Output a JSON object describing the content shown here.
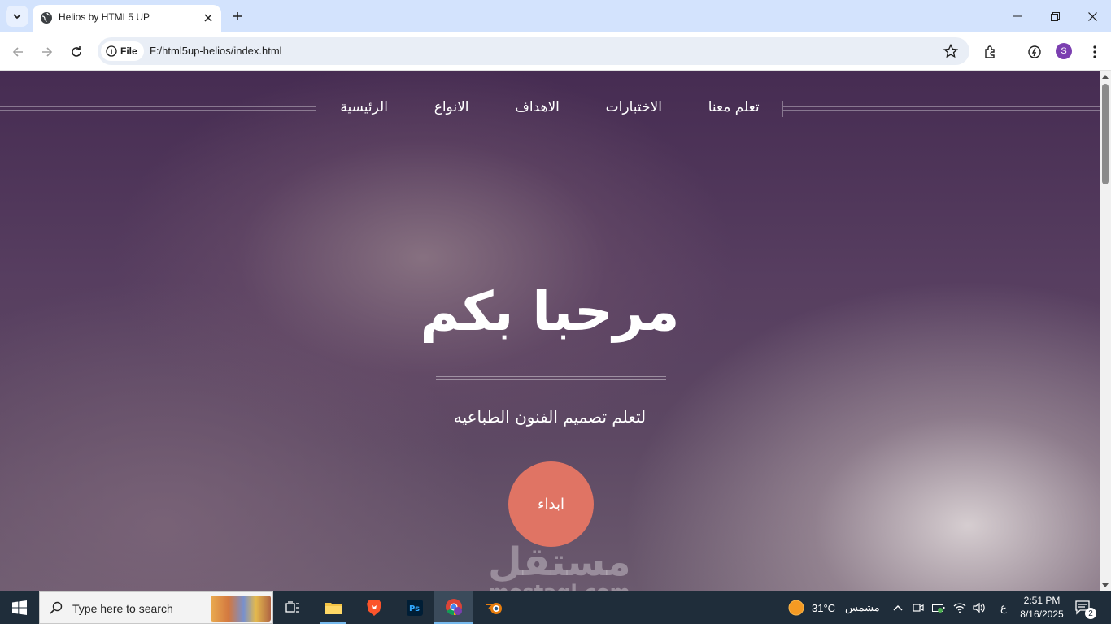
{
  "browser": {
    "tab_title": "Helios by HTML5 UP",
    "url_scheme_label": "File",
    "url": "F:/html5up-helios/index.html",
    "profile_initial": "S"
  },
  "site": {
    "nav": [
      {
        "label": "تعلم معنا"
      },
      {
        "label": "الاختبارات"
      },
      {
        "label": "الاهداف"
      },
      {
        "label": "الانواع"
      },
      {
        "label": "الرئيسية"
      }
    ],
    "hero_title": "مرحبا بكم",
    "hero_subtitle": "لتعلم تصميم الفنون الطباعيه",
    "cta_label": "ابداء",
    "watermark_ar": "مستقل",
    "watermark_latin": "mostaql.com"
  },
  "taskbar": {
    "search_placeholder": "Type here to search",
    "weather_temp": "31°C",
    "weather_desc": "مشمس",
    "lang": "ع",
    "time": "2:51 PM",
    "date": "8/16/2025",
    "notifications": "2"
  },
  "colors": {
    "cta": "#e07464",
    "chrome_tabstrip": "#d3e3fd",
    "taskbar": "#1f2d3a"
  }
}
